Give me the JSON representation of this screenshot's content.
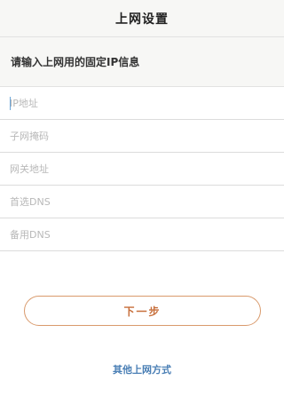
{
  "header": {
    "title": "上网设置"
  },
  "subtitle": "请输入上网用的固定IP信息",
  "fields": [
    {
      "placeholder": "IP地址",
      "value": ""
    },
    {
      "placeholder": "子网掩码",
      "value": ""
    },
    {
      "placeholder": "网关地址",
      "value": ""
    },
    {
      "placeholder": "首选DNS",
      "value": ""
    },
    {
      "placeholder": "备用DNS",
      "value": ""
    }
  ],
  "buttons": {
    "next_label": "下一步"
  },
  "links": {
    "other_method": "其他上网方式"
  },
  "colors": {
    "accent": "#d99a6c",
    "accent_text": "#c76e3a",
    "link": "#4a7fb5",
    "caret": "#6aa5d8"
  }
}
